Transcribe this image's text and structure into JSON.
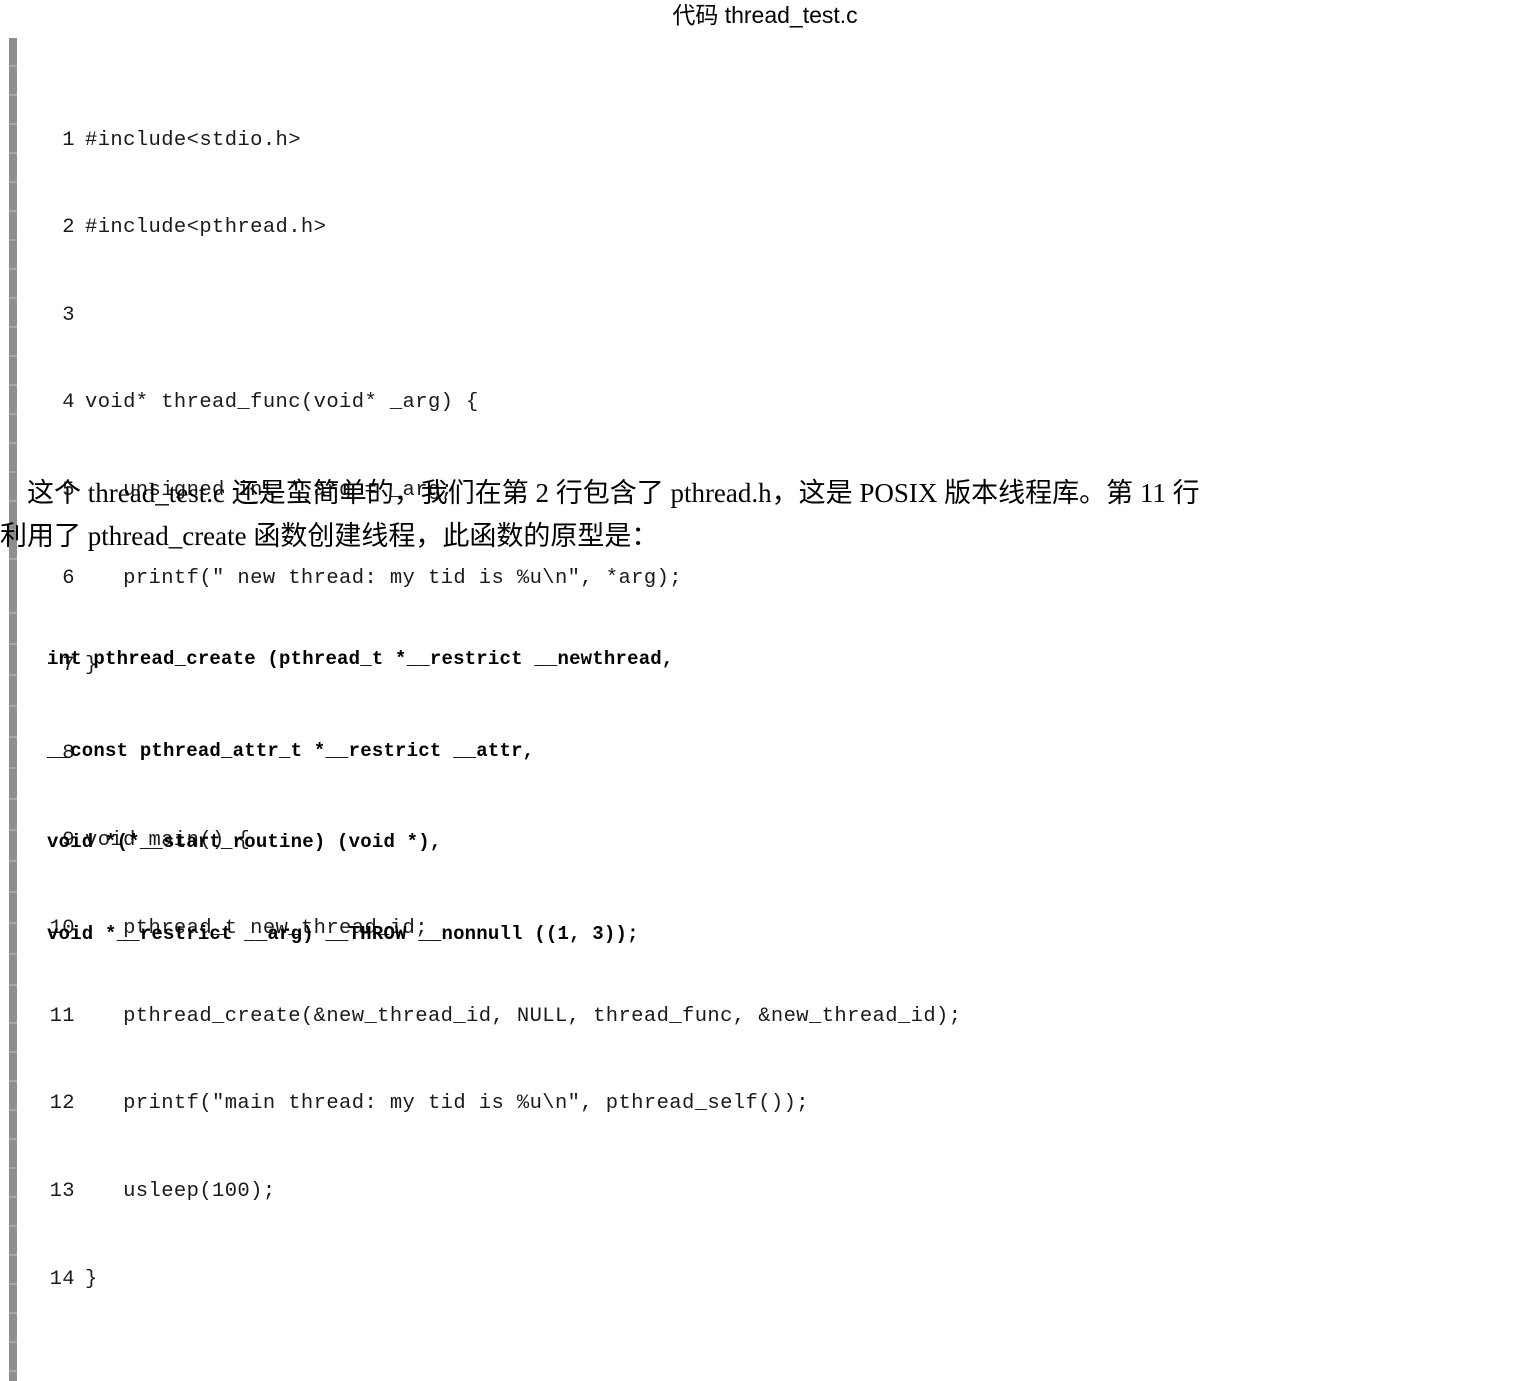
{
  "title": "代码 thread_test.c",
  "code_listing": {
    "name": "thread_test.c",
    "lines": [
      {
        "n": "1",
        "text": "#include<stdio.h>"
      },
      {
        "n": "2",
        "text": "#include<pthread.h>"
      },
      {
        "n": "3",
        "text": ""
      },
      {
        "n": "4",
        "text": "void* thread_func(void* _arg) {"
      },
      {
        "n": "5",
        "text": "   unsigned int * arg = _arg;"
      },
      {
        "n": "6",
        "text": "   printf(\" new thread: my tid is %u\\n\", *arg);"
      },
      {
        "n": "7",
        "text": "}"
      },
      {
        "n": "8",
        "text": ""
      },
      {
        "n": "9",
        "text": "void main() {"
      },
      {
        "n": "10",
        "text": "   pthread_t new_thread_id;"
      },
      {
        "n": "11",
        "text": "   pthread_create(&new_thread_id, NULL, thread_func, &new_thread_id);"
      },
      {
        "n": "12",
        "text": "   printf(\"main thread: my tid is %u\\n\", pthread_self());"
      },
      {
        "n": "13",
        "text": "   usleep(100);"
      },
      {
        "n": "14",
        "text": "}"
      }
    ]
  },
  "paragraph": {
    "line1": "    这个 thread_test.c 还是蛮简单的，我们在第 2 行包含了 pthread.h，这是 POSIX 版本线程库。第 11 行",
    "line2": "利用了 pthread_create 函数创建线程，此函数的原型是："
  },
  "prototype_listing": {
    "lines": [
      "int pthread_create (pthread_t *__restrict __newthread,",
      "__const pthread_attr_t *__restrict __attr,",
      "void *(*__start_routine) (void *),",
      "void *__restrict __arg) __THROW __nonnull ((1, 3));"
    ]
  },
  "colors": {
    "gutter": "#8e8e8e",
    "text": "#000000",
    "background": "#ffffff"
  }
}
